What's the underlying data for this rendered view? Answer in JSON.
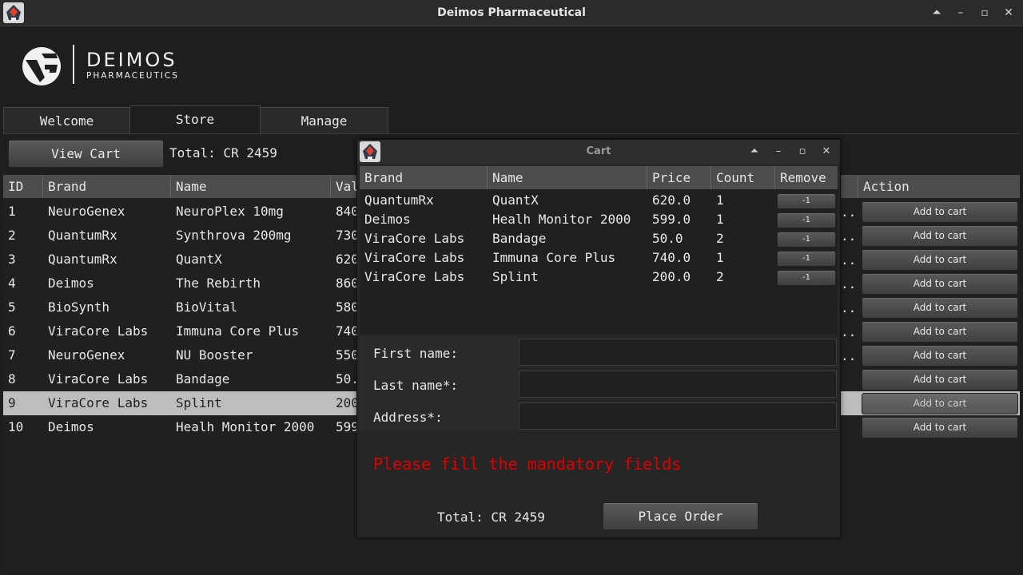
{
  "window": {
    "title": "Deimos Pharmaceutical",
    "controls": [
      "chevron-up-icon",
      "minimize-icon",
      "maximize-icon",
      "close-icon"
    ]
  },
  "logo": {
    "name": "DEIMOS",
    "subtitle": "PHARMACEUTICS"
  },
  "tabs": [
    {
      "label": "Welcome",
      "active": false
    },
    {
      "label": "Store",
      "active": true
    },
    {
      "label": "Manage",
      "active": false
    }
  ],
  "store": {
    "view_cart_label": "View Cart",
    "total_label": "Total: CR 2459",
    "columns": [
      "ID",
      "Brand",
      "Name",
      "Val",
      "Action"
    ],
    "rows": [
      {
        "id": "1",
        "brand": "NeuroGenex",
        "name": "NeuroPlex 10mg",
        "value": "840",
        "action": "Add to cart"
      },
      {
        "id": "2",
        "brand": "QuantumRx",
        "name": "Synthrova 200mg",
        "value": "730",
        "action": "Add to cart"
      },
      {
        "id": "3",
        "brand": "QuantumRx",
        "name": "QuantX",
        "value": "620",
        "action": "Add to cart"
      },
      {
        "id": "4",
        "brand": "Deimos",
        "name": "The Rebirth",
        "value": "860",
        "action": "Add to cart"
      },
      {
        "id": "5",
        "brand": "BioSynth",
        "name": "BioVital",
        "value": "580",
        "action": "Add to cart"
      },
      {
        "id": "6",
        "brand": "ViraCore Labs",
        "name": "Immuna Core Plus",
        "value": "740",
        "action": "Add to cart"
      },
      {
        "id": "7",
        "brand": "NeuroGenex",
        "name": "NU Booster",
        "value": "550",
        "action": "Add to cart"
      },
      {
        "id": "8",
        "brand": "ViraCore Labs",
        "name": "Bandage",
        "value": "50.",
        "action": "Add to cart"
      },
      {
        "id": "9",
        "brand": "ViraCore Labs",
        "name": "Splint",
        "value": "200",
        "action": "Add to cart",
        "selected": true
      },
      {
        "id": "10",
        "brand": "Deimos",
        "name": "Healh Monitor 2000",
        "value": "599",
        "action": "Add to cart"
      }
    ],
    "ellipsis": ".."
  },
  "cart": {
    "title": "Cart",
    "controls": [
      "chevron-up-icon",
      "minimize-icon",
      "maximize-icon",
      "close-icon"
    ],
    "columns": [
      "Brand",
      "Name",
      "Price",
      "Count",
      "Remove"
    ],
    "rows": [
      {
        "brand": "QuantumRx",
        "name": "QuantX",
        "price": "620.0",
        "count": "1",
        "remove": "-1"
      },
      {
        "brand": "Deimos",
        "name": "Healh Monitor 2000",
        "price": "599.0",
        "count": "1",
        "remove": "-1"
      },
      {
        "brand": "ViraCore Labs",
        "name": "Bandage",
        "price": "50.0",
        "count": "2",
        "remove": "-1"
      },
      {
        "brand": "ViraCore Labs",
        "name": "Immuna Core Plus",
        "price": "740.0",
        "count": "1",
        "remove": "-1"
      },
      {
        "brand": "ViraCore Labs",
        "name": "Splint",
        "price": "200.0",
        "count": "2",
        "remove": "-1"
      }
    ],
    "form": {
      "first_name_label": "First name:",
      "last_name_label": "Last name*:",
      "address_label": "Address*:",
      "first_name_value": "",
      "last_name_value": "",
      "address_value": ""
    },
    "error": "Please fill the mandatory fields",
    "total_label": "Total: CR 2459",
    "place_order_label": "Place Order"
  },
  "colors": {
    "error": "#e00000",
    "selected_row": "#bdbdbd",
    "header": "#4d4d4d"
  }
}
